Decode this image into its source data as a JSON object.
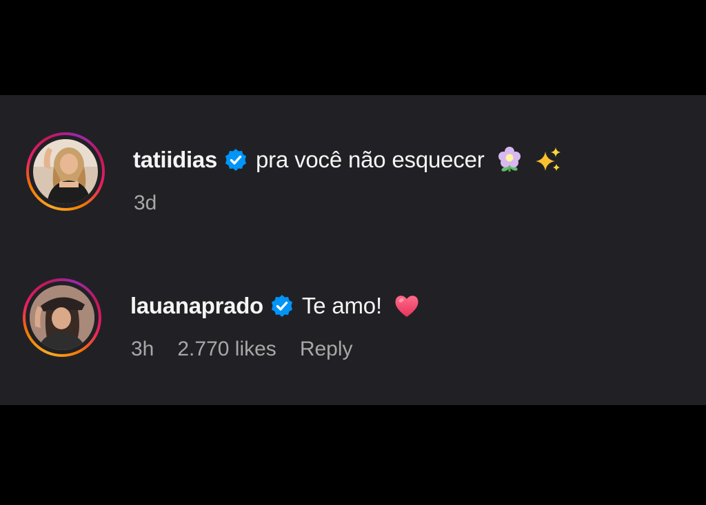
{
  "comments": [
    {
      "username": "tatiidias",
      "verified": true,
      "text": "pra você não esquecer",
      "emojis": [
        "flower-emoji",
        "sparkles-emoji"
      ],
      "time": "3d"
    },
    {
      "username": "lauanaprado",
      "verified": true,
      "text": "Te amo!",
      "emojis": [
        "heart-emoji"
      ],
      "time": "3h",
      "likes": "2.770 likes",
      "reply_label": "Reply"
    }
  ],
  "colors": {
    "background": "#000000",
    "panel": "#212125",
    "verified_badge": "#0095f6",
    "primary_text": "#f5f5f5",
    "secondary_text": "#a8a8a8"
  }
}
